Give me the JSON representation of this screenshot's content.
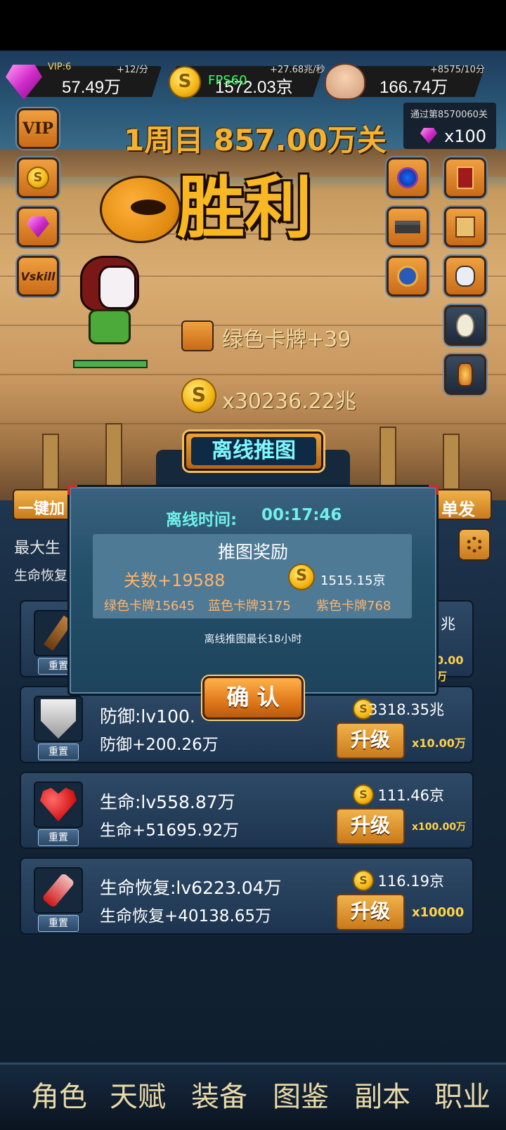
{
  "top_bar": {
    "gems": {
      "small": "VIP:6",
      "rate": "+12/分",
      "value": "57.49万"
    },
    "gold": {
      "small": "FPS60",
      "rate": "+27.68兆/秒",
      "value": "1572.03京"
    },
    "skull": {
      "rate": "+8575/10分",
      "value": "166.74万"
    }
  },
  "pass_reward": {
    "label": "通过第8570060关",
    "value": "x100"
  },
  "level_title": "1周目 857.00万关",
  "victory_text": "胜利",
  "side_left": {
    "vip": "VIP",
    "vskill": "Vskill"
  },
  "drops": {
    "card": "绿色卡牌+39",
    "gold": "x30236.22兆"
  },
  "under_buttons": {
    "left": "一键加",
    "right": "单发"
  },
  "stats": {
    "max_hp": "最大生",
    "regen": "生命恢复"
  },
  "dialog": {
    "title": "离线推图",
    "time_label": "离线时间:",
    "time_value": "00:17:46",
    "reward_title": "推图奖励",
    "levels": "关数+19588",
    "gold": "1515.15京",
    "cards": {
      "green": "绿色卡牌15645",
      "blue": "蓝色卡牌3175",
      "purple": "紫色卡牌768"
    },
    "note": "离线推图最长18小时",
    "confirm": "确 认"
  },
  "items": [
    {
      "name": "attack",
      "line1": "",
      "line2": "",
      "cost": "兆",
      "multiplier": "0.00万",
      "reset": "重置",
      "upgrade": "升级"
    },
    {
      "name": "defense",
      "line1": "防御:lv100.",
      "line2": "防御+200.26万",
      "cost": "3318.35兆",
      "multiplier": "x10.00万",
      "reset": "重置",
      "upgrade": "升级"
    },
    {
      "name": "life",
      "line1": "生命:lv558.87万",
      "line2": "生命+51695.92万",
      "cost": "111.46京",
      "multiplier": "x100.00万",
      "reset": "重置",
      "upgrade": "升级"
    },
    {
      "name": "regen",
      "line1": "生命恢复:lv6223.04万",
      "line2": "生命恢复+40138.65万",
      "cost": "116.19京",
      "multiplier": "x10000",
      "reset": "重置",
      "upgrade": "升级"
    }
  ],
  "nav": [
    "角色",
    "天赋",
    "装备",
    "图鉴",
    "副本",
    "职业"
  ],
  "colors": {
    "accent": "#f0a040",
    "gold": "#ffd24a",
    "teal": "#6ff0e8",
    "red_text": "#ffb46a",
    "panel": "#25506c"
  }
}
